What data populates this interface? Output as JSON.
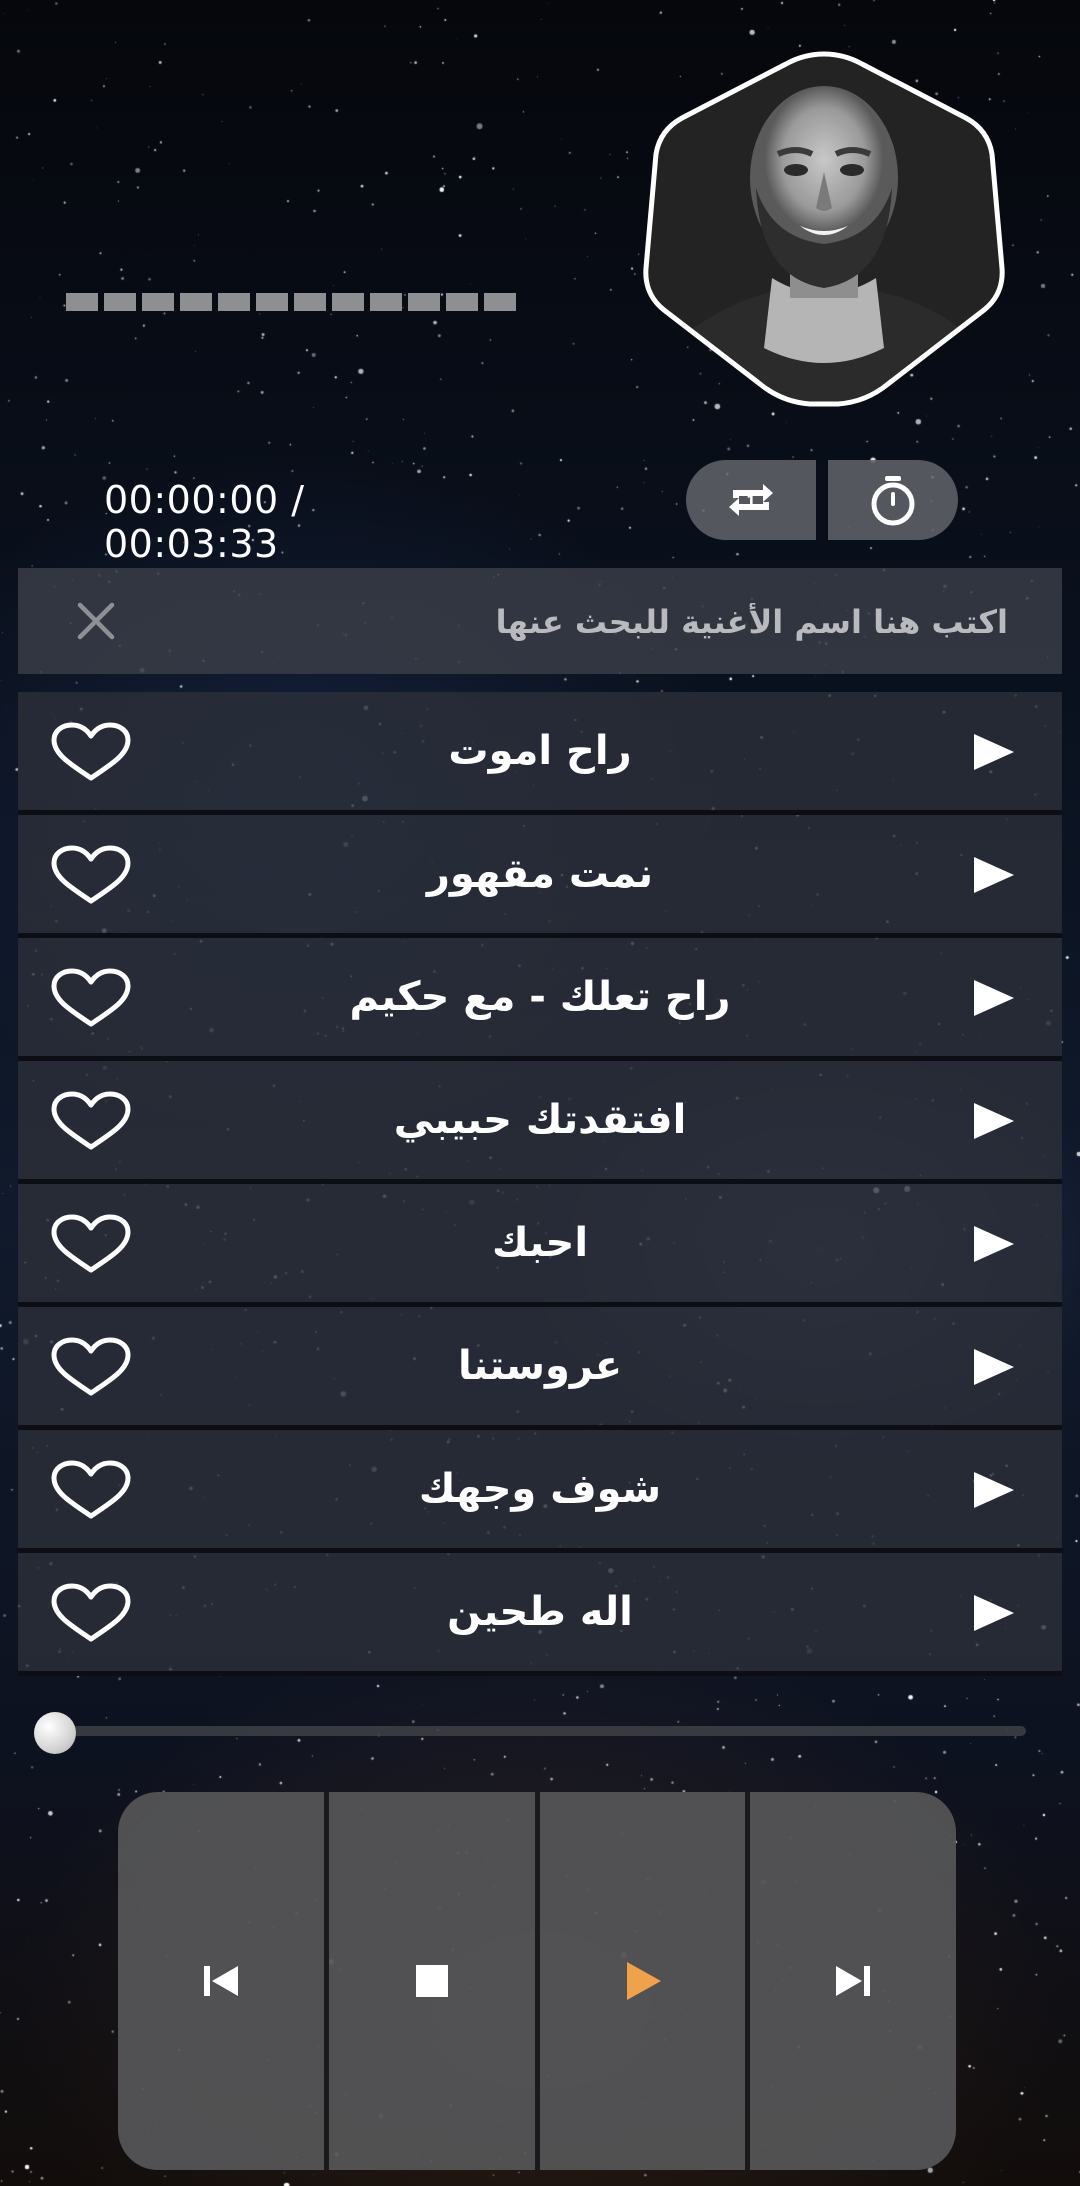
{
  "player": {
    "elapsed": "00:00:00",
    "separator": "/",
    "duration": "00:03:33",
    "time_display": "00:00:00 / 00:03:33",
    "progress_fraction": 0.0
  },
  "search": {
    "placeholder": "اكتب هنا اسم الأغنية للبحث عنها"
  },
  "songs": [
    {
      "title": "راح اموت"
    },
    {
      "title": "نمت مقهور"
    },
    {
      "title": "راح تعلك - مع حكيم"
    },
    {
      "title": "افتقدتك حبيبي"
    },
    {
      "title": "احبك"
    },
    {
      "title": "عروستنا"
    },
    {
      "title": "شوف وجهك"
    },
    {
      "title": "اله طحين"
    }
  ],
  "icons": {
    "repeat": "repeat-one-icon",
    "timer": "stopwatch-icon",
    "clear": "close-icon",
    "favorite": "heart-outline-icon",
    "play_row": "play-icon",
    "previous": "skip-previous-icon",
    "stop": "stop-icon",
    "play": "play-icon",
    "next": "skip-next-icon"
  },
  "colors": {
    "accent_play": "#f0a24a",
    "text": "#ffffff",
    "row_bg": "#2c303a",
    "control_bg": "#545456"
  }
}
